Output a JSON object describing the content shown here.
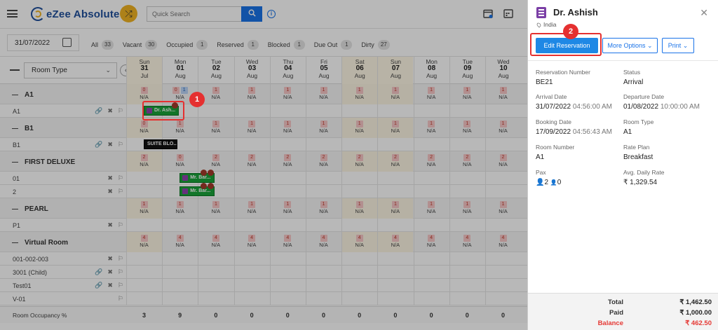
{
  "app": {
    "name": "eZee Absolute"
  },
  "search": {
    "placeholder": "Quick Search"
  },
  "filterbar": {
    "date": "31/07/2022",
    "filters": [
      {
        "label": "All",
        "count": "33"
      },
      {
        "label": "Vacant",
        "count": "30"
      },
      {
        "label": "Occupied",
        "count": "1"
      },
      {
        "label": "Reserved",
        "count": "1"
      },
      {
        "label": "Blocked",
        "count": "1"
      },
      {
        "label": "Due Out",
        "count": "1"
      },
      {
        "label": "Dirty",
        "count": "27"
      }
    ]
  },
  "grid": {
    "roomtype_label": "Room Type",
    "days": [
      {
        "dow": "Sun",
        "day": "31",
        "mon": "Jul",
        "weekend": true
      },
      {
        "dow": "Mon",
        "day": "01",
        "mon": "Aug",
        "weekend": false
      },
      {
        "dow": "Tue",
        "day": "02",
        "mon": "Aug",
        "weekend": false
      },
      {
        "dow": "Wed",
        "day": "03",
        "mon": "Aug",
        "weekend": false
      },
      {
        "dow": "Thu",
        "day": "04",
        "mon": "Aug",
        "weekend": false
      },
      {
        "dow": "Fri",
        "day": "05",
        "mon": "Aug",
        "weekend": false
      },
      {
        "dow": "Sat",
        "day": "06",
        "mon": "Aug",
        "weekend": true
      },
      {
        "dow": "Sun",
        "day": "07",
        "mon": "Aug",
        "weekend": true
      },
      {
        "dow": "Mon",
        "day": "08",
        "mon": "Aug",
        "weekend": false
      },
      {
        "dow": "Tue",
        "day": "09",
        "mon": "Aug",
        "weekend": false
      },
      {
        "dow": "Wed",
        "day": "10",
        "mon": "Aug",
        "weekend": false
      }
    ],
    "na": "N/A",
    "groups": [
      {
        "name": "A1",
        "avail": [
          "0",
          "0|1",
          "1",
          "1",
          "1",
          "1",
          "1",
          "1",
          "1",
          "1",
          "1"
        ],
        "rooms": [
          {
            "name": "A1",
            "icons": 3
          }
        ]
      },
      {
        "name": "B1",
        "avail": [
          "0",
          "1",
          "1",
          "1",
          "1",
          "1",
          "1",
          "1",
          "1",
          "1",
          "1"
        ],
        "rooms": [
          {
            "name": "B1",
            "icons": 3
          }
        ]
      },
      {
        "name": "FIRST DELUXE",
        "avail": [
          "2",
          "0",
          "2",
          "2",
          "2",
          "2",
          "2",
          "2",
          "2",
          "2",
          "2"
        ],
        "rooms": [
          {
            "name": "01",
            "icons": 2
          },
          {
            "name": "2",
            "icons": 2
          }
        ]
      },
      {
        "name": "PEARL",
        "avail": [
          "1",
          "1",
          "1",
          "1",
          "1",
          "1",
          "1",
          "1",
          "1",
          "1",
          "1"
        ],
        "rooms": [
          {
            "name": "P1",
            "icons": 2
          }
        ]
      },
      {
        "name": "Virtual Room",
        "avail": [
          "4",
          "4",
          "4",
          "4",
          "4",
          "4",
          "4",
          "4",
          "4",
          "4",
          "4"
        ],
        "rooms": [
          {
            "name": "001-002-003",
            "icons": 2
          },
          {
            "name": "3001 (Child)",
            "icons": 3
          },
          {
            "name": "Test01",
            "icons": 3
          },
          {
            "name": "V-01",
            "icons": 1
          }
        ]
      }
    ],
    "bookings": {
      "a1": "Dr. Ash...",
      "b1": "SUITE BLO...",
      "fd1": "Mr. Bar...",
      "fd2": "Mr. Bar..."
    },
    "occupancy_label": "Room Occupancy %",
    "occupancy": [
      "3",
      "9",
      "0",
      "0",
      "0",
      "0",
      "0",
      "0",
      "0",
      "0",
      "0"
    ]
  },
  "markers": {
    "one": "1",
    "two": "2"
  },
  "panel": {
    "guest_name": "Dr. Ashish",
    "country": "India",
    "edit_label": "Edit Reservation",
    "more_label": "More Options",
    "print_label": "Print",
    "fields": {
      "res_num_k": "Reservation Number",
      "res_num_v": "BE21",
      "status_k": "Status",
      "status_v": "Arrival",
      "arrival_k": "Arrival Date",
      "arrival_d": "31/07/2022",
      "arrival_t": "04:56:00 AM",
      "departure_k": "Departure Date",
      "departure_d": "01/08/2022",
      "departure_t": "10:00:00 AM",
      "booking_k": "Booking Date",
      "booking_d": "17/09/2022",
      "booking_t": "04:56:43 AM",
      "roomtype_k": "Room Type",
      "roomtype_v": "A1",
      "roomnum_k": "Room Number",
      "roomnum_v": "A1",
      "rateplan_k": "Rate Plan",
      "rateplan_v": "Breakfast",
      "pax_k": "Pax",
      "pax_adults": "2",
      "pax_children": "0",
      "adr_k": "Avg. Daily Rate",
      "adr_v": "₹ 1,329.54"
    },
    "totals": {
      "total_k": "Total",
      "total_v": "₹ 1,462.50",
      "paid_k": "Paid",
      "paid_v": "₹ 1,000.00",
      "balance_k": "Balance",
      "balance_v": "₹ 462.50"
    }
  }
}
